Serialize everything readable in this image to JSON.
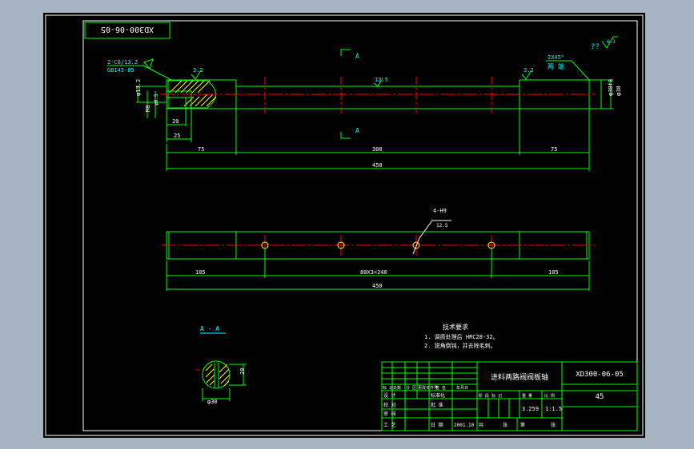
{
  "colors": {
    "background": "#000000",
    "border": "#ffffff",
    "outline": "#00ff00",
    "centerline": "#ff0000",
    "hatch": "#ffff00",
    "dimension_text": "#ffffff",
    "annotation_text": "#00ffff"
  },
  "drawing_number_rotated": "XD300-06-05",
  "top_view": {
    "tolerance_note": "??",
    "roughness_corner": "6.3",
    "section_label_top": "A",
    "section_label_bottom": "A",
    "center_hole_note_line1": "2-C8/13.2",
    "center_hole_note_line2": "GB145-85",
    "roughness_left": "3.2",
    "roughness_mid": "12.5",
    "roughness_right": "3.2",
    "chamfer_note_line1": "2X45°",
    "chamfer_note_line2": "两 端",
    "left_diameter": "φ13.2",
    "thread_size": "M8",
    "thread_diameter": "φ8.5",
    "right_diameter_1": "φ30f8",
    "right_diameter_2": "φ30",
    "dim_20": "20",
    "dim_25": "25",
    "dim_75_left": "75",
    "dim_300": "300",
    "dim_75_right": "75",
    "dim_450": "450"
  },
  "side_view": {
    "hole_note": "4-H9",
    "hole_roughness": "12.5",
    "dim_105_left": "105",
    "dim_80x3": "80X3=240",
    "dim_105_right": "105",
    "dim_450": "450"
  },
  "section": {
    "label": "A - A",
    "dim_20": "20",
    "dim_diameter": "φ30"
  },
  "tech_req": {
    "title": "技术要求",
    "item1": "1. 调质处理后 HRC28-32。",
    "item2": "2. 锐角倒钝，并去除毛刺。"
  },
  "title_block": {
    "part_name": "进料两路阀阀板轴",
    "drawing_number": "XD300-06-05",
    "material": "45",
    "mark_label": "标 记",
    "count_label": "处数",
    "zone_label": "分 区",
    "change_label": "更改文件号",
    "sign_label": "签 名",
    "date_label": "年月日",
    "design_label": "设 计",
    "standard_label": "标准化",
    "check_label": "校 对",
    "review_label": "审 核",
    "process_label": "工 艺",
    "approve_label": "批 准",
    "date_short": "日 期",
    "date_value": "2001.10",
    "stage_label": "阶 段 标 记",
    "weight_label": "重 量",
    "scale_label": "比 例",
    "weight_value": "3.259",
    "scale_value": "1:1.5",
    "total_label": "共",
    "sheet_label": "张",
    "nth_label": "第",
    "sheets_label": "张"
  }
}
